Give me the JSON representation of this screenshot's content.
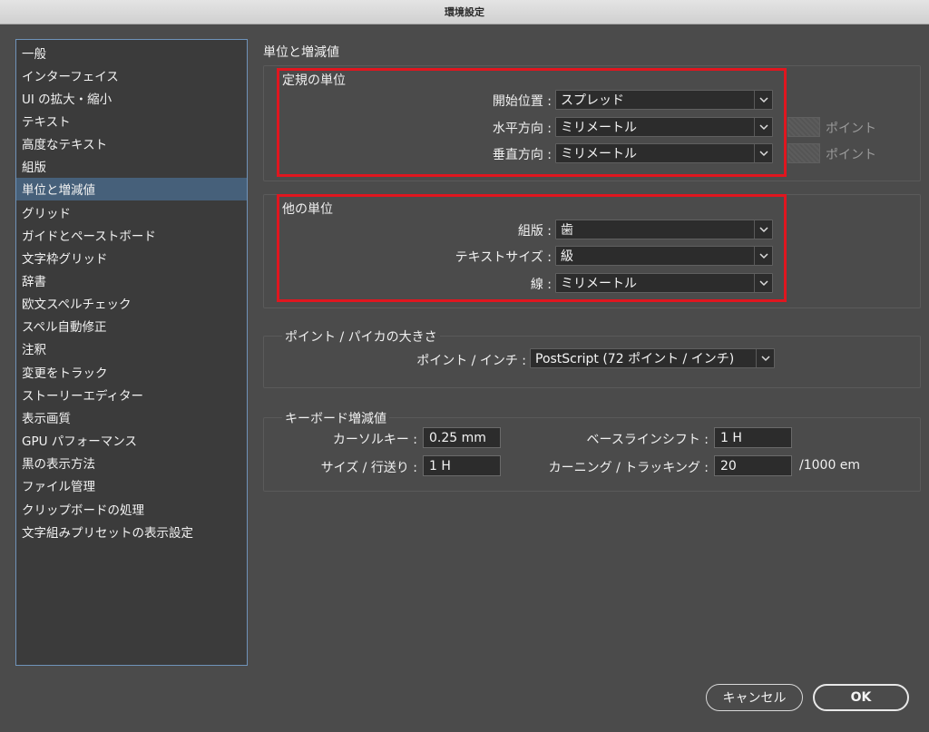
{
  "window": {
    "title": "環境設定"
  },
  "sidebar": {
    "items": [
      "一般",
      "インターフェイス",
      "UI の拡大・縮小",
      "テキスト",
      "高度なテキスト",
      "組版",
      "単位と増減値",
      "グリッド",
      "ガイドとペーストボード",
      "文字枠グリッド",
      "辞書",
      "欧文スペルチェック",
      "スペル自動修正",
      "注釈",
      "変更をトラック",
      "ストーリーエディター",
      "表示画質",
      "GPU パフォーマンス",
      "黒の表示方法",
      "ファイル管理",
      "クリップボードの処理",
      "文字組みプリセットの表示設定"
    ],
    "selected_index": 6
  },
  "panel": {
    "title": "単位と増減値",
    "ruler_units": {
      "title": "定規の単位",
      "origin_label": "開始位置 :",
      "origin_value": "スプレッド",
      "horizontal_label": "水平方向 :",
      "horizontal_value": "ミリメートル",
      "horizontal_unit": "ポイント",
      "vertical_label": "垂直方向 :",
      "vertical_value": "ミリメートル",
      "vertical_unit": "ポイント"
    },
    "other_units": {
      "title": "他の単位",
      "composition_label": "組版 :",
      "composition_value": "歯",
      "text_size_label": "テキストサイズ :",
      "text_size_value": "級",
      "stroke_label": "線 :",
      "stroke_value": "ミリメートル"
    },
    "point_pica": {
      "title": "ポイント / パイカの大きさ",
      "label": "ポイント / インチ :",
      "value": "PostScript (72 ポイント / インチ)"
    },
    "keyboard": {
      "title": "キーボード増減値",
      "cursor_label": "カーソルキー :",
      "cursor_value": "0.25 mm",
      "baseline_label": "ベースラインシフト :",
      "baseline_value": "1 H",
      "size_label": "サイズ / 行送り :",
      "size_value": "1 H",
      "kerning_label": "カーニング / トラッキング :",
      "kerning_value": "20",
      "kerning_unit": "/1000 em"
    }
  },
  "buttons": {
    "cancel": "キャンセル",
    "ok": "OK"
  },
  "colors": {
    "highlight": "#e0161f",
    "selection": "#46607a",
    "sidebar_border": "#6f93b9"
  }
}
